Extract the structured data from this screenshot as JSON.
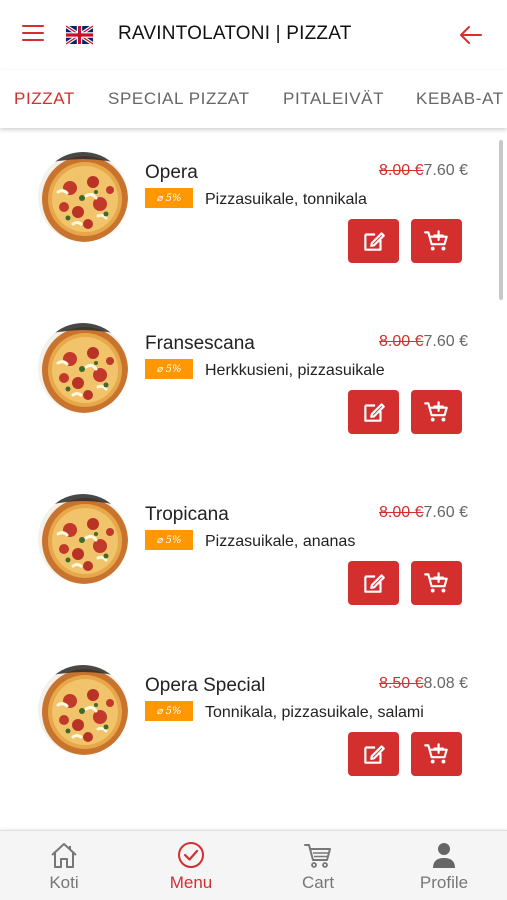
{
  "header": {
    "title": "RAVINTOLATONI | PIZZAT",
    "menu_icon": "hamburger-menu-icon",
    "language_flag": "uk-flag-icon",
    "back_icon": "arrow-left-icon",
    "accent_color": "#d32f2f"
  },
  "tabs": [
    {
      "label": "PIZZAT",
      "active": true
    },
    {
      "label": "SPECIAL PIZZAT",
      "active": false
    },
    {
      "label": "PITALEIVÄT",
      "active": false
    },
    {
      "label": "KEBAB-AT",
      "active": false
    }
  ],
  "items": [
    {
      "name": "Opera",
      "old_price": "8.00 €",
      "new_price": "7.60 €",
      "discount": "5%",
      "description": "Pizzasuikale, tonnikala"
    },
    {
      "name": "Fransescana",
      "old_price": "8.00 €",
      "new_price": "7.60 €",
      "discount": "5%",
      "description": "Herkkusieni, pizzasuikale"
    },
    {
      "name": "Tropicana",
      "old_price": "8.00 €",
      "new_price": "7.60 €",
      "discount": "5%",
      "description": "Pizzasuikale, ananas"
    },
    {
      "name": "Opera Special",
      "old_price": "8.50 €",
      "new_price": "8.08 €",
      "discount": "5%",
      "description": "Tonnikala, pizzasuikale, salami"
    }
  ],
  "item_buttons": {
    "edit_icon": "edit-note-icon",
    "cart_icon": "add-to-cart-icon"
  },
  "discount_color": "#ff9800",
  "bottom_nav": [
    {
      "label": "Koti",
      "icon": "home-icon",
      "active": false
    },
    {
      "label": "Menu",
      "icon": "check-circle-icon",
      "active": true
    },
    {
      "label": "Cart",
      "icon": "cart-icon",
      "active": false
    },
    {
      "label": "Profile",
      "icon": "person-icon",
      "active": false
    }
  ]
}
